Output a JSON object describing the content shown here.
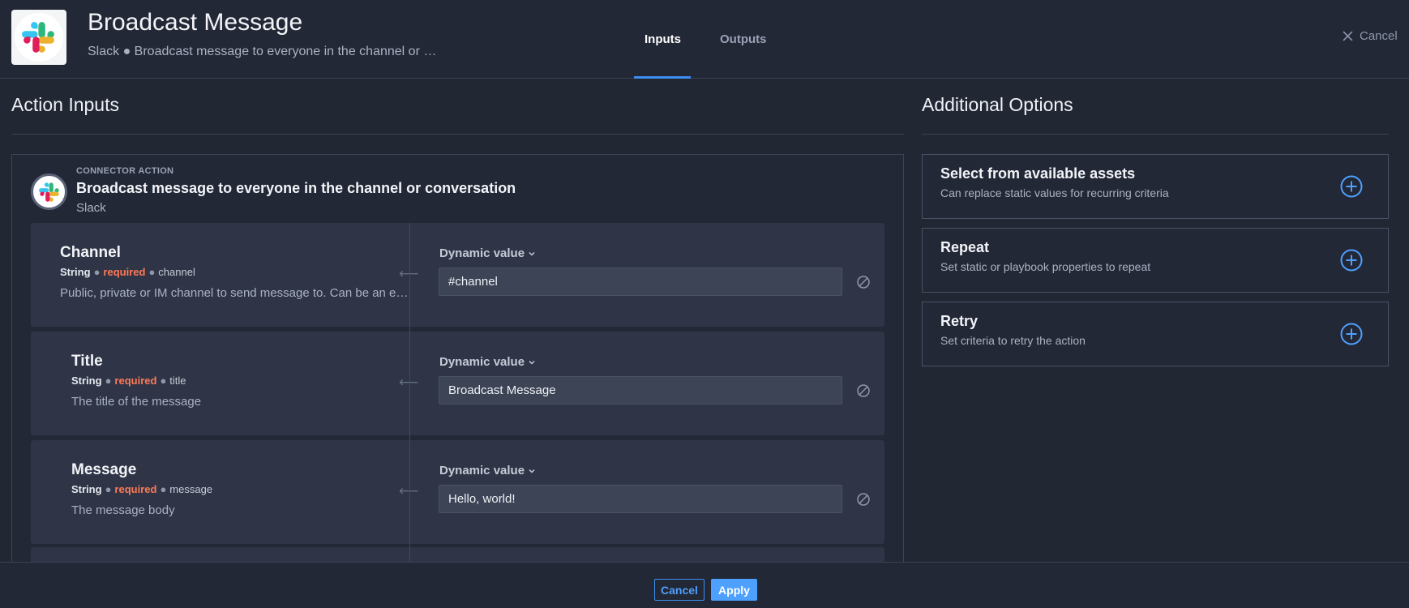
{
  "header": {
    "title": "Broadcast Message",
    "subtitle": "Slack ● Broadcast message to everyone in the channel or …",
    "tabs": [
      {
        "label": "Inputs",
        "active": true
      },
      {
        "label": "Outputs",
        "active": false
      }
    ],
    "cancel_label": "Cancel",
    "logo_icon": "slack-logo-icon"
  },
  "action_inputs": {
    "section_title": "Action Inputs",
    "connector_label": "CONNECTOR ACTION",
    "connector_title": "Broadcast message to everyone in the channel or conversation",
    "connector_app": "Slack",
    "fields": [
      {
        "name": "Channel",
        "type": "String",
        "required": "required",
        "key": "channel",
        "description": "Public, private or IM channel to send message to. Can be an encoded ID, or a name.",
        "dynamic_label": "Dynamic value",
        "value": "#channel"
      },
      {
        "name": "Title",
        "type": "String",
        "required": "required",
        "key": "title",
        "description": "The title of the message",
        "dynamic_label": "Dynamic value",
        "value": "Broadcast Message"
      },
      {
        "name": "Message",
        "type": "String",
        "required": "required",
        "key": "message",
        "description": "The message body",
        "dynamic_label": "Dynamic value",
        "value": "Hello, world!"
      }
    ]
  },
  "additional_options": {
    "section_title": "Additional Options",
    "options": [
      {
        "title": "Select from available assets",
        "description": "Can replace static values for recurring criteria"
      },
      {
        "title": "Repeat",
        "description": "Set static or playbook properties to repeat"
      },
      {
        "title": "Retry",
        "description": "Set criteria to retry the action"
      }
    ]
  },
  "footer": {
    "cancel_label": "Cancel",
    "apply_label": "Apply"
  },
  "colors": {
    "accent": "#4ea0ff",
    "required": "#ff7a59",
    "background": "#222734"
  }
}
